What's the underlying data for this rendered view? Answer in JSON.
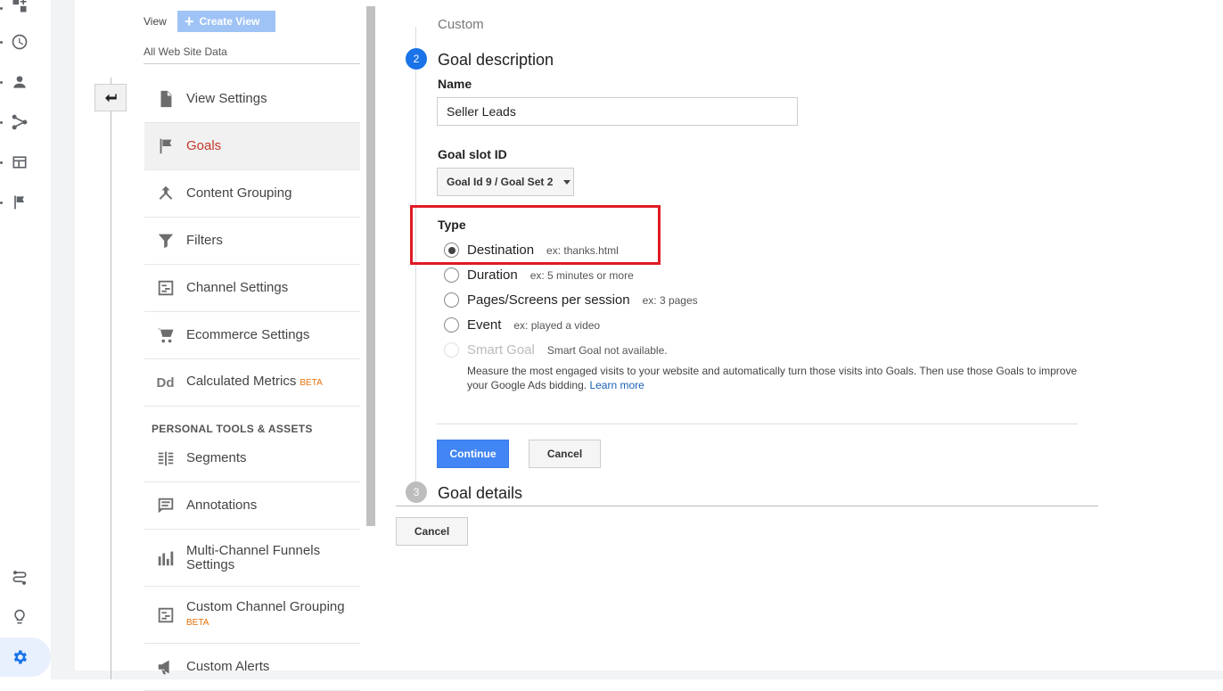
{
  "rail": {
    "icons": [
      "add-report-icon",
      "clock-icon",
      "person-icon",
      "fork-icon",
      "layout-icon",
      "flag-icon",
      "route-icon",
      "lightbulb-icon",
      "gear-icon"
    ]
  },
  "panel": {
    "view_label": "View",
    "create_view_label": "Create View",
    "all_web_site_data": "All Web Site Data",
    "menu_items": [
      {
        "label": "View Settings",
        "icon": "document-icon"
      },
      {
        "label": "Goals",
        "icon": "flag-icon",
        "active": true
      },
      {
        "label": "Content Grouping",
        "icon": "merge-icon"
      },
      {
        "label": "Filters",
        "icon": "filter-icon"
      },
      {
        "label": "Channel Settings",
        "icon": "channel-icon"
      },
      {
        "label": "Ecommerce Settings",
        "icon": "cart-icon"
      },
      {
        "label": "Calculated Metrics",
        "icon": "dd-icon",
        "badge": "BETA"
      }
    ],
    "section_header": "PERSONAL TOOLS & ASSETS",
    "tools_items": [
      {
        "label": "Segments",
        "icon": "segments-icon"
      },
      {
        "label": "Annotations",
        "icon": "annotation-icon"
      },
      {
        "label": "Multi-Channel Funnels Settings",
        "line1": "Multi-Channel Funnels",
        "line2": "Settings",
        "icon": "bar-chart-icon"
      },
      {
        "label": "Custom Channel Grouping",
        "icon": "channel-icon",
        "badge": "BETA"
      },
      {
        "label": "Custom Alerts",
        "icon": "megaphone-icon"
      }
    ]
  },
  "goal": {
    "prev_step_text": "Custom",
    "step2_number": "2",
    "step2_title": "Goal description",
    "name_label": "Name",
    "name_value": "Seller Leads",
    "slot_label": "Goal slot ID",
    "slot_value": "Goal Id 9 / Goal Set 2",
    "type_label": "Type",
    "types": [
      {
        "label": "Destination",
        "example": "ex: thanks.html",
        "checked": true
      },
      {
        "label": "Duration",
        "example": "ex: 5 minutes or more"
      },
      {
        "label": "Pages/Screens per session",
        "example": "ex: 3 pages"
      },
      {
        "label": "Event",
        "example": "ex: played a video"
      },
      {
        "label": "Smart Goal",
        "example": "Smart Goal not available.",
        "disabled": true
      }
    ],
    "smart_desc": "Measure the most engaged visits to your website and automatically turn those visits into Goals. Then use those Goals to improve your Google Ads bidding.",
    "learn_more": "Learn more",
    "continue_label": "Continue",
    "cancel_label": "Cancel",
    "step3_number": "3",
    "step3_title": "Goal details",
    "bottom_cancel_label": "Cancel"
  },
  "colors": {
    "accent_blue": "#4285f4",
    "active_red": "#c5372c",
    "highlight_box": "#e01b24",
    "beta_orange": "#e8710a"
  }
}
